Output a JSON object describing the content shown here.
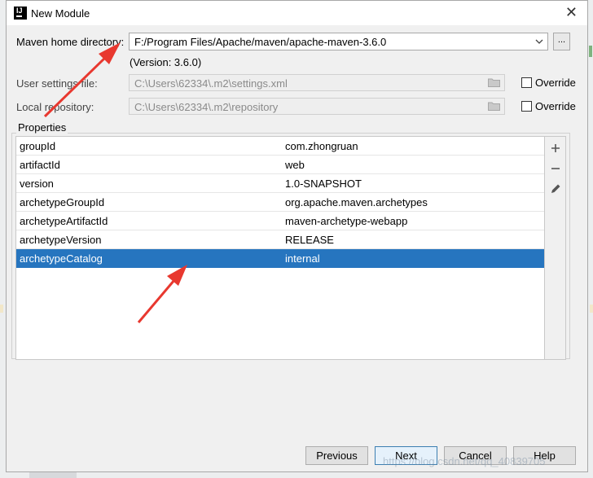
{
  "window": {
    "title": "New Module"
  },
  "maven": {
    "home_label": "Maven home directory:",
    "home_value": "F:/Program Files/Apache/maven/apache-maven-3.6.0",
    "browse_label": "...",
    "version_text": "(Version: 3.6.0)",
    "settings_label": "User settings file:",
    "settings_value": "C:\\Users\\62334\\.m2\\settings.xml",
    "repo_label": "Local repository:",
    "repo_value": "C:\\Users\\62334\\.m2\\repository",
    "override_label": "Override",
    "settings_override_checked": false,
    "repo_override_checked": false
  },
  "properties": {
    "title": "Properties",
    "rows": [
      {
        "key": "groupId",
        "value": "com.zhongruan"
      },
      {
        "key": "artifactId",
        "value": "web"
      },
      {
        "key": "version",
        "value": "1.0-SNAPSHOT"
      },
      {
        "key": "archetypeGroupId",
        "value": "org.apache.maven.archetypes"
      },
      {
        "key": "archetypeArtifactId",
        "value": "maven-archetype-webapp"
      },
      {
        "key": "archetypeVersion",
        "value": "RELEASE"
      },
      {
        "key": "archetypeCatalog",
        "value": "internal"
      }
    ],
    "selected_row": 6,
    "add_icon": "plus-icon",
    "remove_icon": "minus-icon",
    "edit_icon": "pencil-icon"
  },
  "buttons": {
    "previous": "Previous",
    "next": "Next",
    "cancel": "Cancel",
    "help": "Help"
  },
  "watermark": "https://blog.csdn.net/qq_40839705",
  "colors": {
    "selection": "#2675bf",
    "annotation_arrow": "#e8382f"
  }
}
